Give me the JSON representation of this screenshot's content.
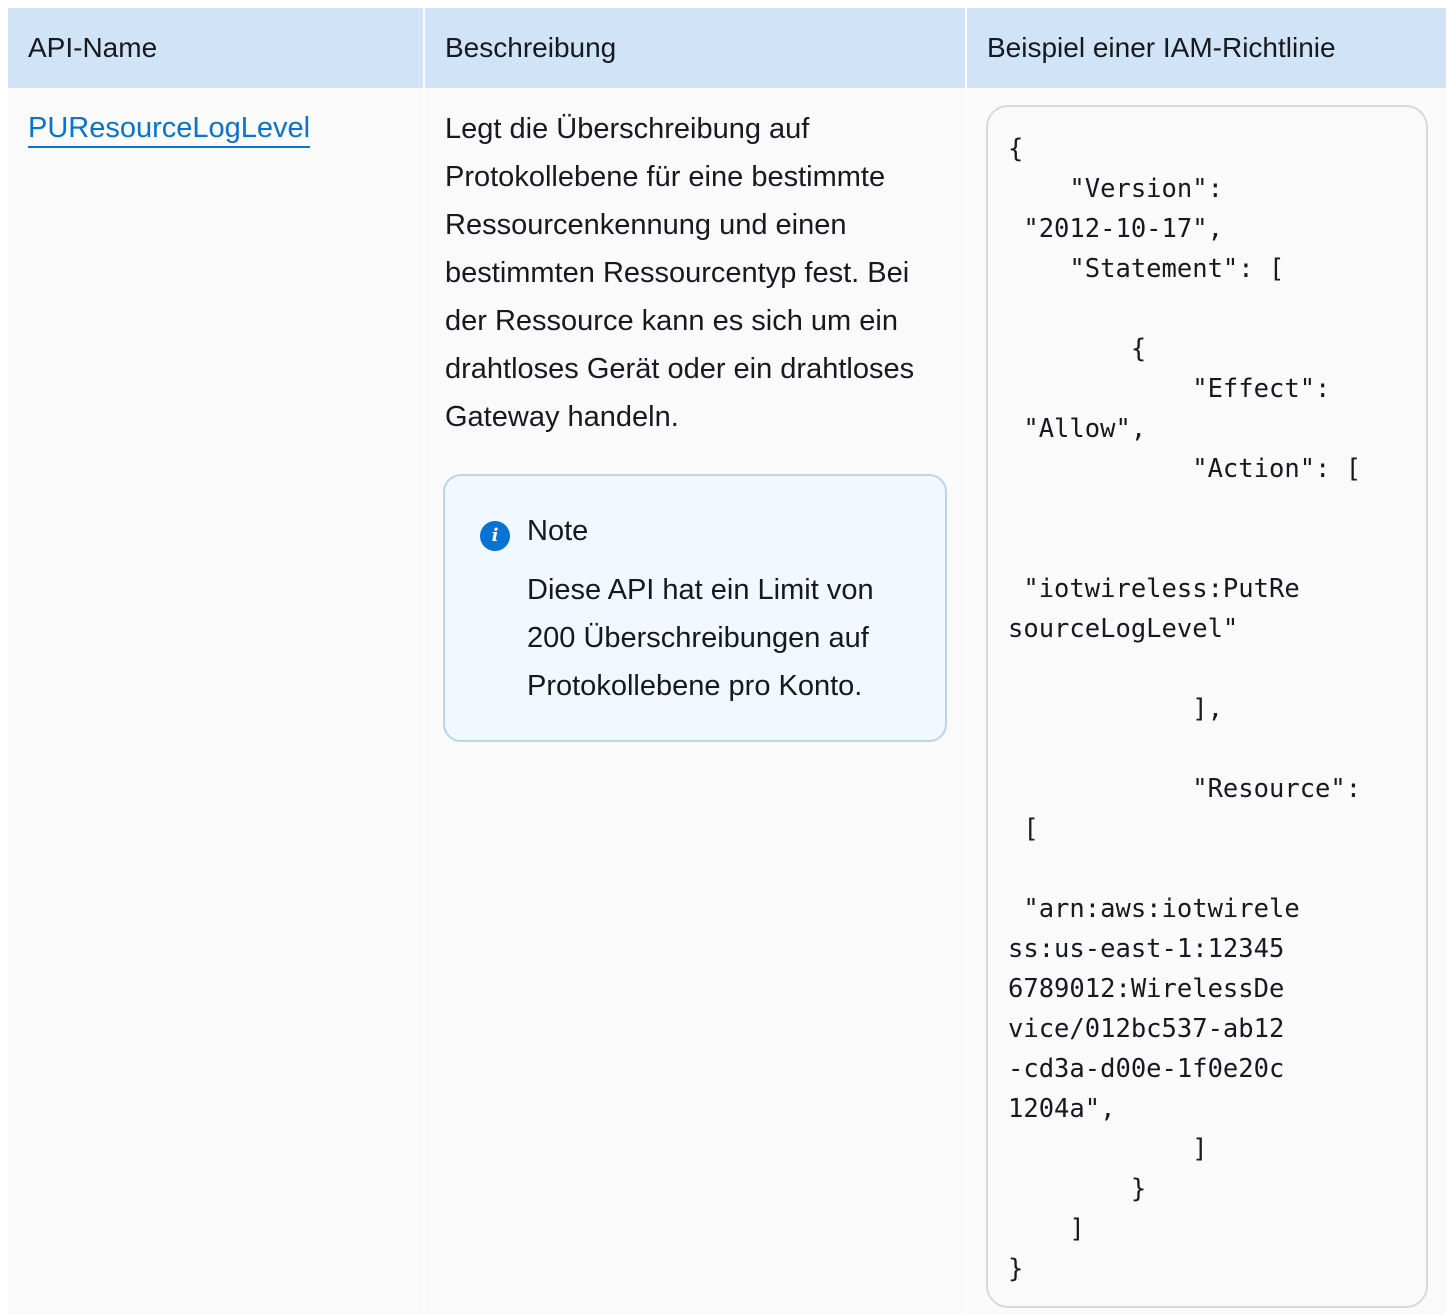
{
  "table": {
    "headers": [
      "API-Name",
      "Beschreibung",
      "Beispiel einer IAM-Richtlinie"
    ],
    "row": {
      "api_name": "PUResourceLogLevel",
      "description": "Legt die Überschreibung auf Protokollebene für eine bestimmte Ressourcenkennung und einen bestimmten Ressourcentyp fest. Bei der Ressource kann es sich um ein drahtloses Gerät oder ein drahtloses Gateway handeln.",
      "note": {
        "icon": "info-icon",
        "title": "Note",
        "body": "Diese API hat ein Limit von 200 Überschreibungen auf Protokollebene pro Konto."
      },
      "policy_example": "{\n    \"Version\":\n \"2012-10-17\",\n    \"Statement\": [\n\n        {\n            \"Effect\":\n \"Allow\",\n            \"Action\": [\n\n\n \"iotwireless:PutRe\nsourceLogLevel\"\n\n            ],\n\n            \"Resource\":\n [\n\n \"arn:aws:iotwirele\nss:us-east-1:12345\n6789012:WirelessDe\nvice/012bc537-ab12\n-cd3a-d00e-1f0e20c\n1204a\",\n            ]\n        }\n    ]\n}"
    }
  },
  "colors": {
    "header_bg": "#d1e4f7",
    "link": "#0972d3",
    "note_border": "#b8d4ee",
    "note_bg": "#f1f8ff",
    "code_border": "#d5dbdb"
  }
}
